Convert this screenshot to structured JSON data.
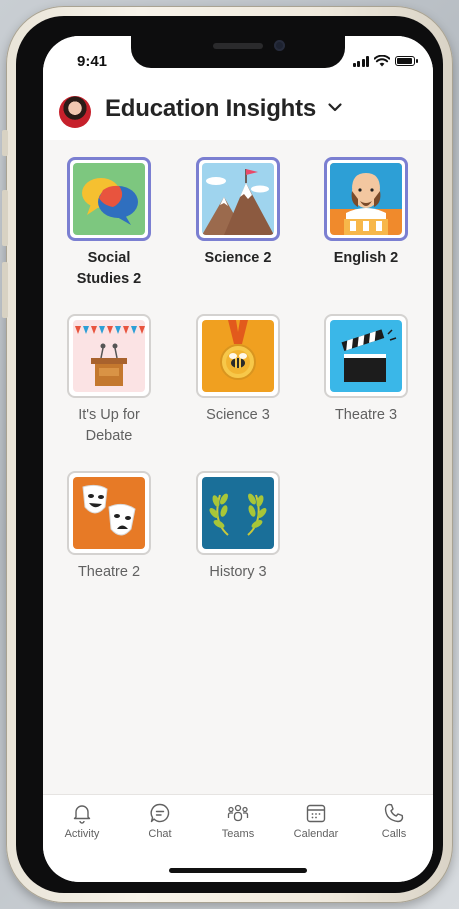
{
  "status_bar": {
    "time": "9:41"
  },
  "header": {
    "title": "Education Insights",
    "avatar_icon": "user-avatar",
    "chevron_icon": "chevron-down-icon"
  },
  "classes": [
    {
      "name": "Social\nStudies 2",
      "selected": true,
      "icon": "speech-bubbles"
    },
    {
      "name": "Science 2",
      "selected": true,
      "icon": "mountain-flag"
    },
    {
      "name": "English 2",
      "selected": true,
      "icon": "shakespeare"
    },
    {
      "name": "It's Up for\nDebate",
      "selected": false,
      "icon": "podium-bunting"
    },
    {
      "name": "Science 3",
      "selected": false,
      "icon": "medal-bee"
    },
    {
      "name": "Theatre 3",
      "selected": false,
      "icon": "clapperboard"
    },
    {
      "name": "Theatre 2",
      "selected": false,
      "icon": "theatre-masks"
    },
    {
      "name": "History 3",
      "selected": false,
      "icon": "laurel-wreath"
    }
  ],
  "tabs": [
    {
      "label": "Activity",
      "icon": "bell-icon"
    },
    {
      "label": "Chat",
      "icon": "chat-icon"
    },
    {
      "label": "Teams",
      "icon": "teams-icon"
    },
    {
      "label": "Calendar",
      "icon": "calendar-icon"
    },
    {
      "label": "Calls",
      "icon": "phone-icon"
    }
  ],
  "colors": {
    "accent": "#7b7fd1",
    "text_primary": "#242424",
    "text_secondary": "#616161"
  }
}
